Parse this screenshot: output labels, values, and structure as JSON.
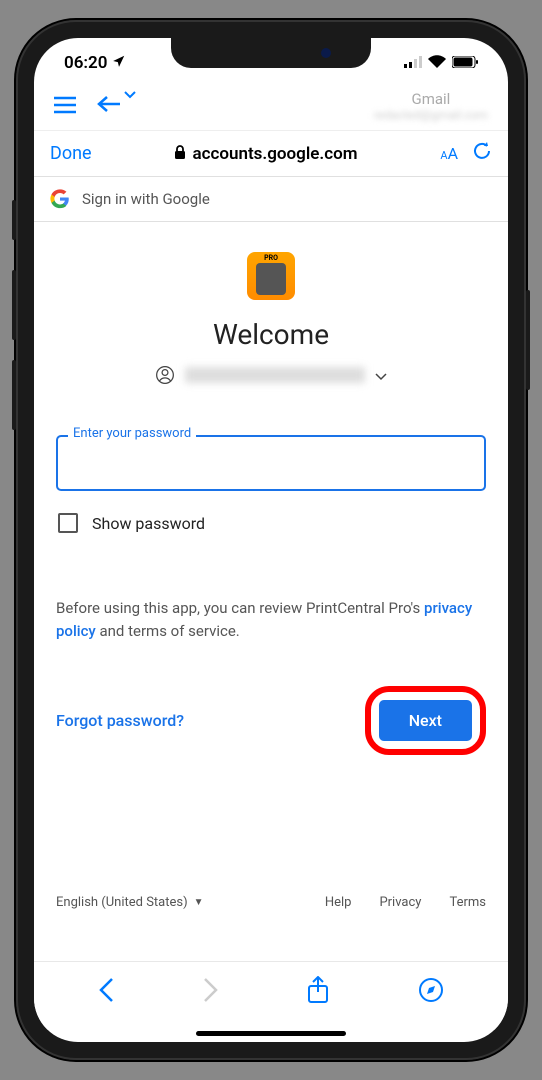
{
  "status": {
    "time": "06:20",
    "location_icon": "location-arrow"
  },
  "app_header": {
    "gmail_label": "Gmail"
  },
  "browser": {
    "done_label": "Done",
    "url": "accounts.google.com",
    "text_size_small": "A",
    "text_size_large": "A"
  },
  "google_header": {
    "signin_text": "Sign in with Google"
  },
  "main": {
    "app_name": "PrintCentral Pro",
    "welcome": "Welcome",
    "password_label": "Enter your password",
    "password_value": "",
    "show_password_label": "Show password",
    "disclosure_prefix": "Before using this app, you can review PrintCentral Pro's ",
    "disclosure_link1": "privacy policy",
    "disclosure_mid": " and terms of service.",
    "forgot_label": "Forgot password?",
    "next_label": "Next"
  },
  "footer": {
    "language": "English (United States)",
    "help": "Help",
    "privacy": "Privacy",
    "terms": "Terms"
  }
}
